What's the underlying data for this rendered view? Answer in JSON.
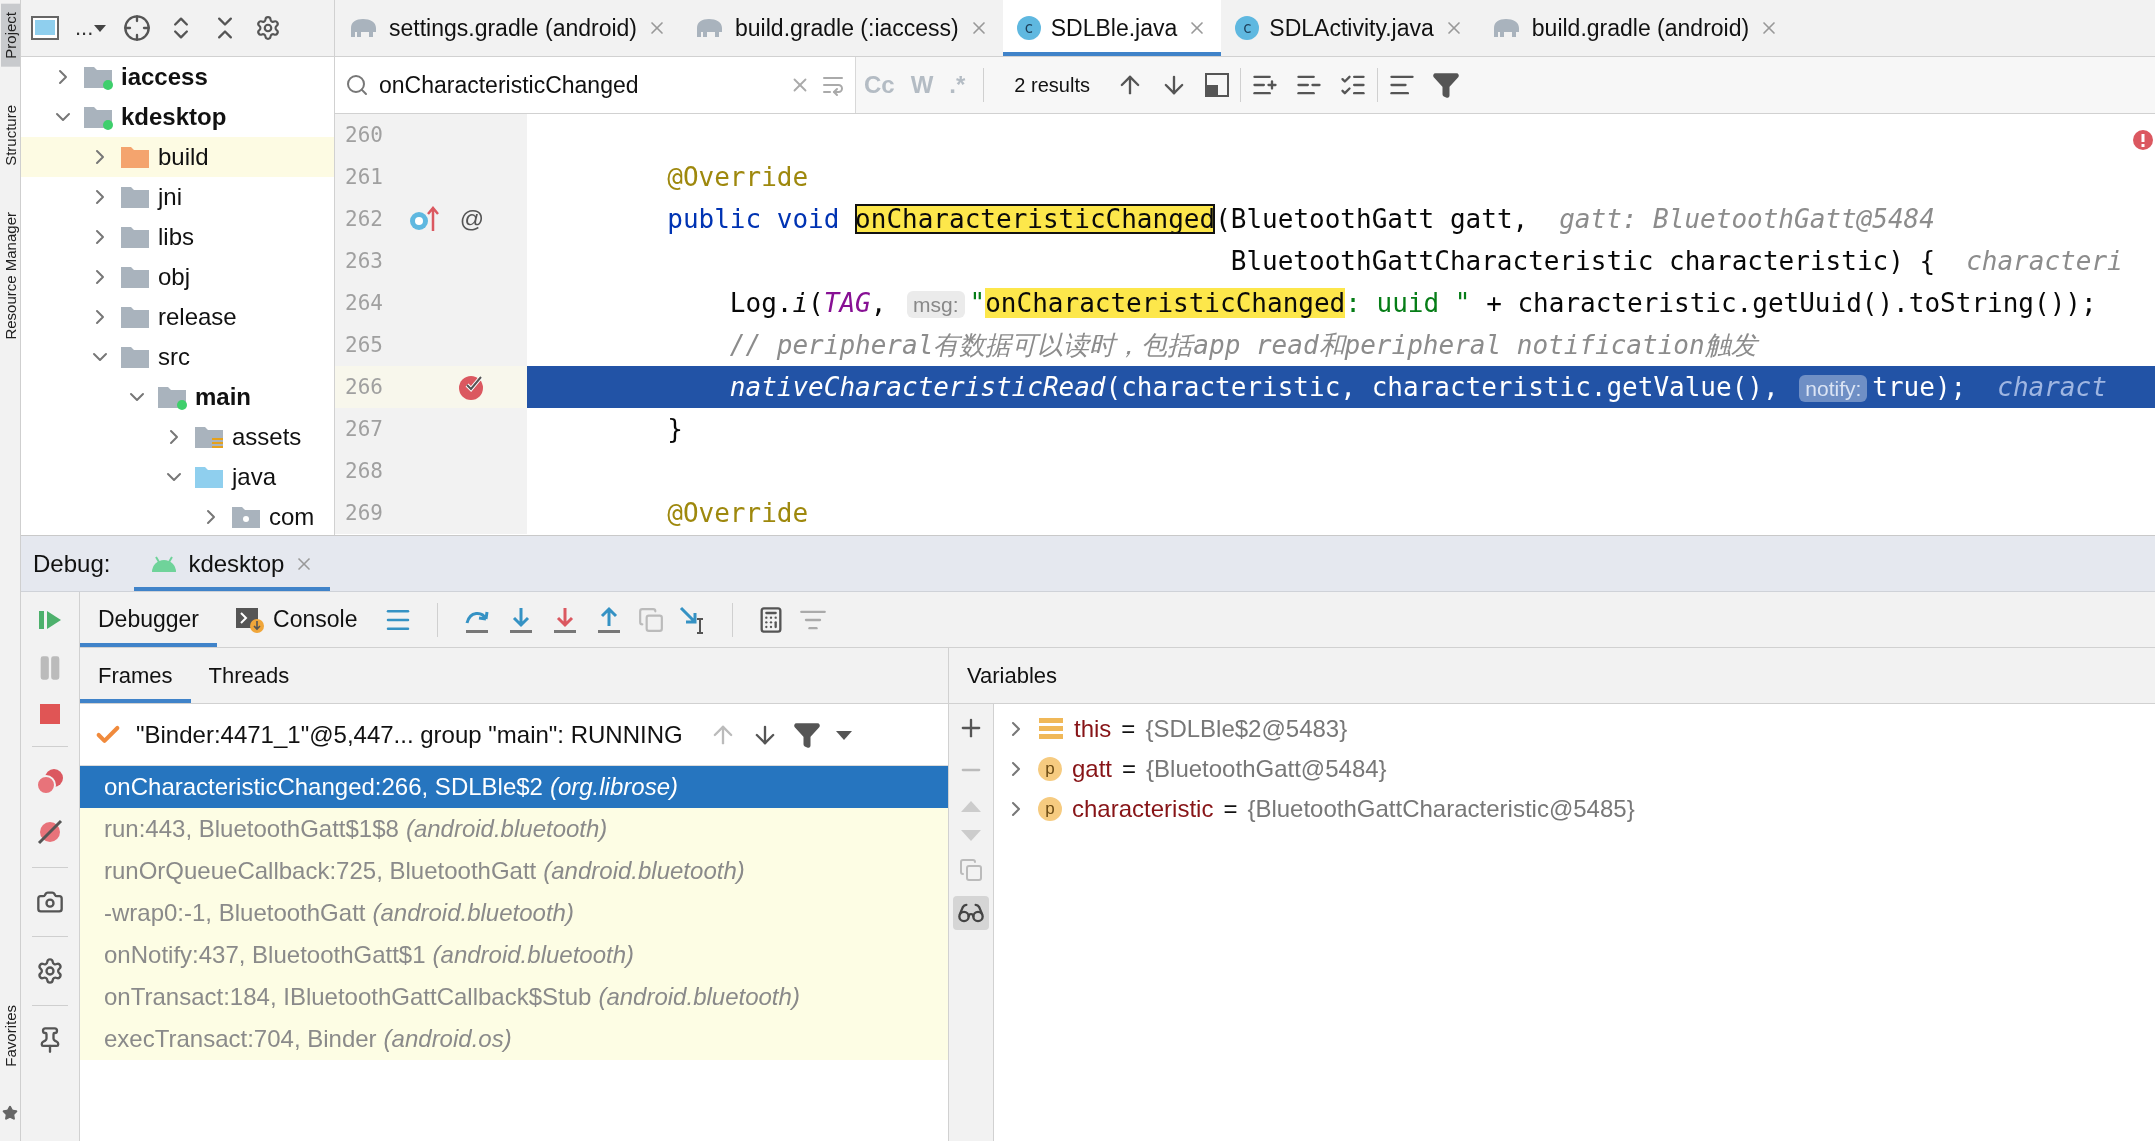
{
  "tool_strip": {
    "top": [
      {
        "label": "Project",
        "selected": true
      },
      {
        "label": "Structure",
        "selected": false
      },
      {
        "label": "Resource Manager",
        "selected": false
      }
    ],
    "bottom": [
      {
        "label": "Favorites",
        "selected": false
      }
    ]
  },
  "project": {
    "toolbar_label": "...",
    "tree": [
      {
        "label": "iaccess",
        "kind": "module",
        "expanded": false,
        "selected": false
      },
      {
        "label": "kdesktop",
        "kind": "module",
        "expanded": true,
        "selected": false,
        "children": [
          {
            "label": "build",
            "kind": "excluded",
            "expanded": false,
            "selected": true
          },
          {
            "label": "jni",
            "kind": "folder",
            "expanded": false,
            "selected": false
          },
          {
            "label": "libs",
            "kind": "folder",
            "expanded": false,
            "selected": false
          },
          {
            "label": "obj",
            "kind": "folder",
            "expanded": false,
            "selected": false
          },
          {
            "label": "release",
            "kind": "folder",
            "expanded": false,
            "selected": false
          },
          {
            "label": "src",
            "kind": "folder",
            "expanded": true,
            "selected": false,
            "children": [
              {
                "label": "main",
                "kind": "source_set",
                "expanded": true,
                "selected": false,
                "children": [
                  {
                    "label": "assets",
                    "kind": "resources",
                    "expanded": false,
                    "selected": false
                  },
                  {
                    "label": "java",
                    "kind": "sources",
                    "expanded": true,
                    "selected": false,
                    "children": [
                      {
                        "label": "com",
                        "kind": "package",
                        "expanded": false,
                        "selected": false
                      }
                    ]
                  }
                ]
              }
            ]
          }
        ]
      }
    ]
  },
  "editor_tabs": [
    {
      "label": "settings.gradle (android)",
      "kind": "gradle",
      "selected": false
    },
    {
      "label": "build.gradle (:iaccess)",
      "kind": "gradle",
      "selected": false
    },
    {
      "label": "SDLBle.java",
      "kind": "java",
      "badge": "c",
      "selected": true
    },
    {
      "label": "SDLActivity.java",
      "kind": "java",
      "badge": "c",
      "selected": false
    },
    {
      "label": "build.gradle (android)",
      "kind": "gradle",
      "selected": false
    }
  ],
  "search": {
    "value": "onCharacteristicChanged",
    "options": [
      "Cc",
      "W",
      ".*"
    ],
    "results": "2 results"
  },
  "code_lines": [
    {
      "number": "260",
      "current": false,
      "breakpoint": false,
      "override": false
    },
    {
      "number": "261",
      "current": false,
      "breakpoint": false,
      "override": false,
      "segments": [
        {
          "kind": "annotation",
          "text": "        @Override"
        }
      ]
    },
    {
      "number": "262",
      "current": false,
      "breakpoint": false,
      "override": true,
      "annotation_mark": "@",
      "segments": [
        {
          "kind": "keyword",
          "text": "        public "
        },
        {
          "kind": "keyword",
          "text": "void "
        },
        {
          "kind": "match_current",
          "text": "onCharacteristicChanged"
        },
        {
          "kind": "plain",
          "text": "(BluetoothGatt gatt,"
        },
        {
          "kind": "inlay",
          "text": "gatt: BluetoothGatt@5484"
        }
      ]
    },
    {
      "number": "263",
      "current": false,
      "breakpoint": false,
      "override": false,
      "segments": [
        {
          "kind": "plain",
          "text": "                                            BluetoothGattCharacteristic characteristic) {"
        },
        {
          "kind": "inlay",
          "text": "characteri"
        }
      ]
    },
    {
      "number": "264",
      "current": false,
      "breakpoint": false,
      "override": false,
      "segments": [
        {
          "kind": "plain",
          "text": "            Log."
        },
        {
          "kind": "static",
          "text": "i"
        },
        {
          "kind": "plain",
          "text": "("
        },
        {
          "kind": "field",
          "text": "TAG"
        },
        {
          "kind": "plain",
          "text": ", "
        },
        {
          "kind": "hint",
          "text": "msg:"
        },
        {
          "kind": "string",
          "text": "\""
        },
        {
          "kind": "match",
          "text": "onCharacteristicChanged"
        },
        {
          "kind": "string",
          "text": ": uuid \""
        },
        {
          "kind": "plain",
          "text": " + characteristic.getUuid().toString());"
        }
      ]
    },
    {
      "number": "265",
      "current": false,
      "breakpoint": false,
      "override": false,
      "segments": [
        {
          "kind": "comment",
          "text": "            // peripheral有数据可以读时，包括app read和peripheral notification触发"
        }
      ]
    },
    {
      "number": "266",
      "current": true,
      "breakpoint": true,
      "override": false,
      "segments": [
        {
          "kind": "static",
          "text": "            nativeCharacteristicRead"
        },
        {
          "kind": "plain",
          "text": "(characteristic, characteristic.getValue(), "
        },
        {
          "kind": "hint",
          "text": "notify:"
        },
        {
          "kind": "plain",
          "text": "true);"
        },
        {
          "kind": "inlay",
          "text": "charact"
        }
      ]
    },
    {
      "number": "267",
      "current": false,
      "breakpoint": false,
      "override": false,
      "segments": [
        {
          "kind": "plain",
          "text": "        }"
        }
      ]
    },
    {
      "number": "268",
      "current": false,
      "breakpoint": false,
      "override": false
    },
    {
      "number": "269",
      "current": false,
      "breakpoint": false,
      "override": false,
      "segments": [
        {
          "kind": "annotation",
          "text": "        @Override"
        }
      ]
    }
  ],
  "debug": {
    "label": "Debug:",
    "session_tabs": [
      {
        "label": "kdesktop",
        "selected": true
      }
    ],
    "tabs": [
      {
        "label": "Debugger",
        "kind": "debugger",
        "selected": true
      },
      {
        "label": "Console",
        "kind": "console",
        "selected": false
      }
    ],
    "frames_tabs": [
      {
        "label": "Frames",
        "selected": true
      },
      {
        "label": "Threads",
        "selected": false
      }
    ],
    "thread": "\"Binder:4471_1\"@5,447... group \"main\": RUNNING",
    "frames": [
      {
        "location": "onCharacteristicChanged:266, SDLBle$2",
        "package": "(org.librose)",
        "selected": true,
        "library": false
      },
      {
        "location": "run:443, BluetoothGatt$1$8",
        "package": "(android.bluetooth)",
        "selected": false,
        "library": true
      },
      {
        "location": "runOrQueueCallback:725, BluetoothGatt",
        "package": "(android.bluetooth)",
        "selected": false,
        "library": true
      },
      {
        "location": "-wrap0:-1, BluetoothGatt",
        "package": "(android.bluetooth)",
        "selected": false,
        "library": true
      },
      {
        "location": "onNotify:437, BluetoothGatt$1",
        "package": "(android.bluetooth)",
        "selected": false,
        "library": true
      },
      {
        "location": "onTransact:184, IBluetoothGattCallback$Stub",
        "package": "(android.bluetooth)",
        "selected": false,
        "library": true
      },
      {
        "location": "execTransact:704, Binder",
        "package": "(android.os)",
        "selected": false,
        "library": true
      }
    ],
    "variables_title": "Variables",
    "variables": [
      {
        "kind": "field",
        "name": "this",
        "separator": "=",
        "value": "{SDLBle$2@5483}"
      },
      {
        "kind": "param",
        "badge": "p",
        "name": "gatt",
        "separator": "=",
        "value": "{BluetoothGatt@5484}"
      },
      {
        "kind": "param",
        "badge": "p",
        "name": "characteristic",
        "separator": "=",
        "value": "{BluetoothGattCharacteristic@5485}"
      }
    ]
  }
}
